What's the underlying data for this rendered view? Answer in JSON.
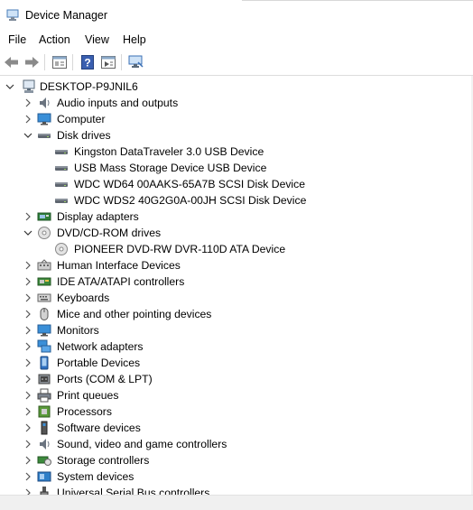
{
  "window": {
    "title": "Device Manager"
  },
  "menu": [
    "File",
    "Action",
    "View",
    "Help"
  ],
  "toolbar": {
    "buttons": [
      "back-icon",
      "forward-icon",
      "properties-icon",
      "help-icon",
      "update-driver-icon",
      "scan-hardware-icon"
    ]
  },
  "tree": {
    "root": "DESKTOP-P9JNIL6",
    "items": [
      {
        "label": "Audio inputs and outputs",
        "level": 1,
        "state": "collapsed",
        "icon": "speaker-icon"
      },
      {
        "label": "Computer",
        "level": 1,
        "state": "collapsed",
        "icon": "monitor-icon"
      },
      {
        "label": "Disk drives",
        "level": 1,
        "state": "expanded",
        "icon": "disk-drive-icon"
      },
      {
        "label": "Kingston DataTraveler 3.0 USB Device",
        "level": 2,
        "state": "leaf",
        "icon": "disk-drive-icon"
      },
      {
        "label": "USB Mass  Storage Device USB Device",
        "level": 2,
        "state": "leaf",
        "icon": "disk-drive-icon"
      },
      {
        "label": "WDC WD64 00AAKS-65A7B SCSI Disk Device",
        "level": 2,
        "state": "leaf",
        "icon": "disk-drive-icon"
      },
      {
        "label": "WDC WDS2 40G2G0A-00JH SCSI Disk Device",
        "level": 2,
        "state": "leaf",
        "icon": "disk-drive-icon"
      },
      {
        "label": "Display adapters",
        "level": 1,
        "state": "collapsed",
        "icon": "display-adapter-icon"
      },
      {
        "label": "DVD/CD-ROM drives",
        "level": 1,
        "state": "expanded",
        "icon": "optical-disc-icon"
      },
      {
        "label": "PIONEER DVD-RW  DVR-110D ATA Device",
        "level": 2,
        "state": "leaf",
        "icon": "optical-disc-icon"
      },
      {
        "label": "Human Interface Devices",
        "level": 1,
        "state": "collapsed",
        "icon": "hid-icon"
      },
      {
        "label": "IDE ATA/ATAPI controllers",
        "level": 1,
        "state": "collapsed",
        "icon": "ide-controller-icon"
      },
      {
        "label": "Keyboards",
        "level": 1,
        "state": "collapsed",
        "icon": "keyboard-icon"
      },
      {
        "label": "Mice and other pointing devices",
        "level": 1,
        "state": "collapsed",
        "icon": "mouse-icon"
      },
      {
        "label": "Monitors",
        "level": 1,
        "state": "collapsed",
        "icon": "monitor-icon"
      },
      {
        "label": "Network adapters",
        "level": 1,
        "state": "collapsed",
        "icon": "network-adapter-icon"
      },
      {
        "label": "Portable Devices",
        "level": 1,
        "state": "collapsed",
        "icon": "portable-device-icon"
      },
      {
        "label": "Ports (COM & LPT)",
        "level": 1,
        "state": "collapsed",
        "icon": "port-icon"
      },
      {
        "label": "Print queues",
        "level": 1,
        "state": "collapsed",
        "icon": "printer-icon"
      },
      {
        "label": "Processors",
        "level": 1,
        "state": "collapsed",
        "icon": "processor-icon"
      },
      {
        "label": "Software devices",
        "level": 1,
        "state": "collapsed",
        "icon": "software-device-icon"
      },
      {
        "label": "Sound, video and game controllers",
        "level": 1,
        "state": "collapsed",
        "icon": "speaker-icon"
      },
      {
        "label": "Storage controllers",
        "level": 1,
        "state": "collapsed",
        "icon": "storage-controller-icon"
      },
      {
        "label": "System devices",
        "level": 1,
        "state": "collapsed",
        "icon": "system-device-icon"
      },
      {
        "label": "Universal Serial Bus controllers",
        "level": 1,
        "state": "collapsed",
        "icon": "usb-controller-icon"
      }
    ]
  },
  "colors": {
    "accent": "#1e74c8",
    "toolbar_icon": "#3a6fb5"
  }
}
